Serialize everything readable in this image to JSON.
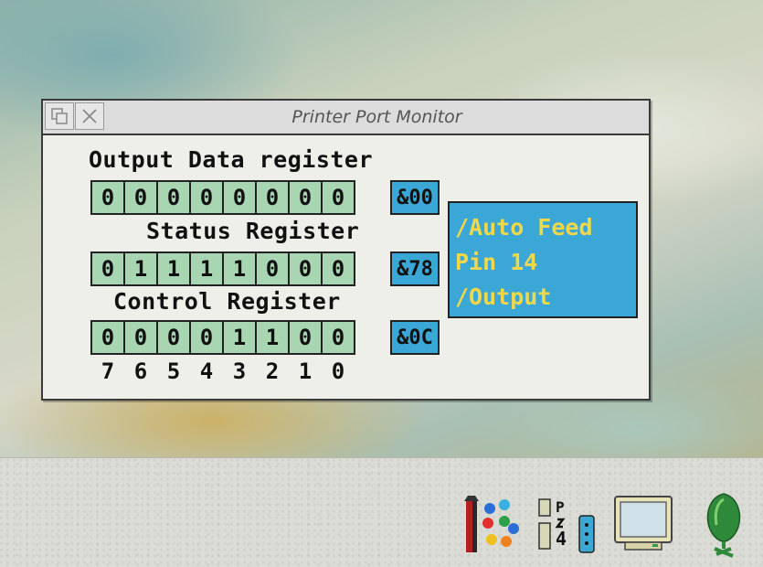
{
  "window": {
    "title": "Printer Port Monitor"
  },
  "registers": [
    {
      "title": "Output Data register",
      "bits": [
        "0",
        "0",
        "0",
        "0",
        "0",
        "0",
        "0",
        "0"
      ],
      "hex": "&00"
    },
    {
      "title": "Status Register",
      "bits": [
        "0",
        "1",
        "1",
        "1",
        "1",
        "0",
        "0",
        "0"
      ],
      "hex": "&78"
    },
    {
      "title": "Control Register",
      "bits": [
        "0",
        "0",
        "0",
        "0",
        "1",
        "1",
        "0",
        "0"
      ],
      "hex": "&0C"
    }
  ],
  "bit_numbers": [
    "7",
    "6",
    "5",
    "4",
    "3",
    "2",
    "1",
    "0"
  ],
  "info": {
    "lines": [
      "/Auto Feed",
      "Pin 14",
      "/Output"
    ]
  },
  "colors": {
    "bit_cell": "#a9d6b2",
    "hex_cell": "#3aa7d6",
    "info_text": "#f0d84a"
  },
  "iconbar": {
    "icons": [
      "paint-app-icon",
      "printer-driver-icon",
      "display-monitor-icon",
      "acorn-icon"
    ]
  }
}
